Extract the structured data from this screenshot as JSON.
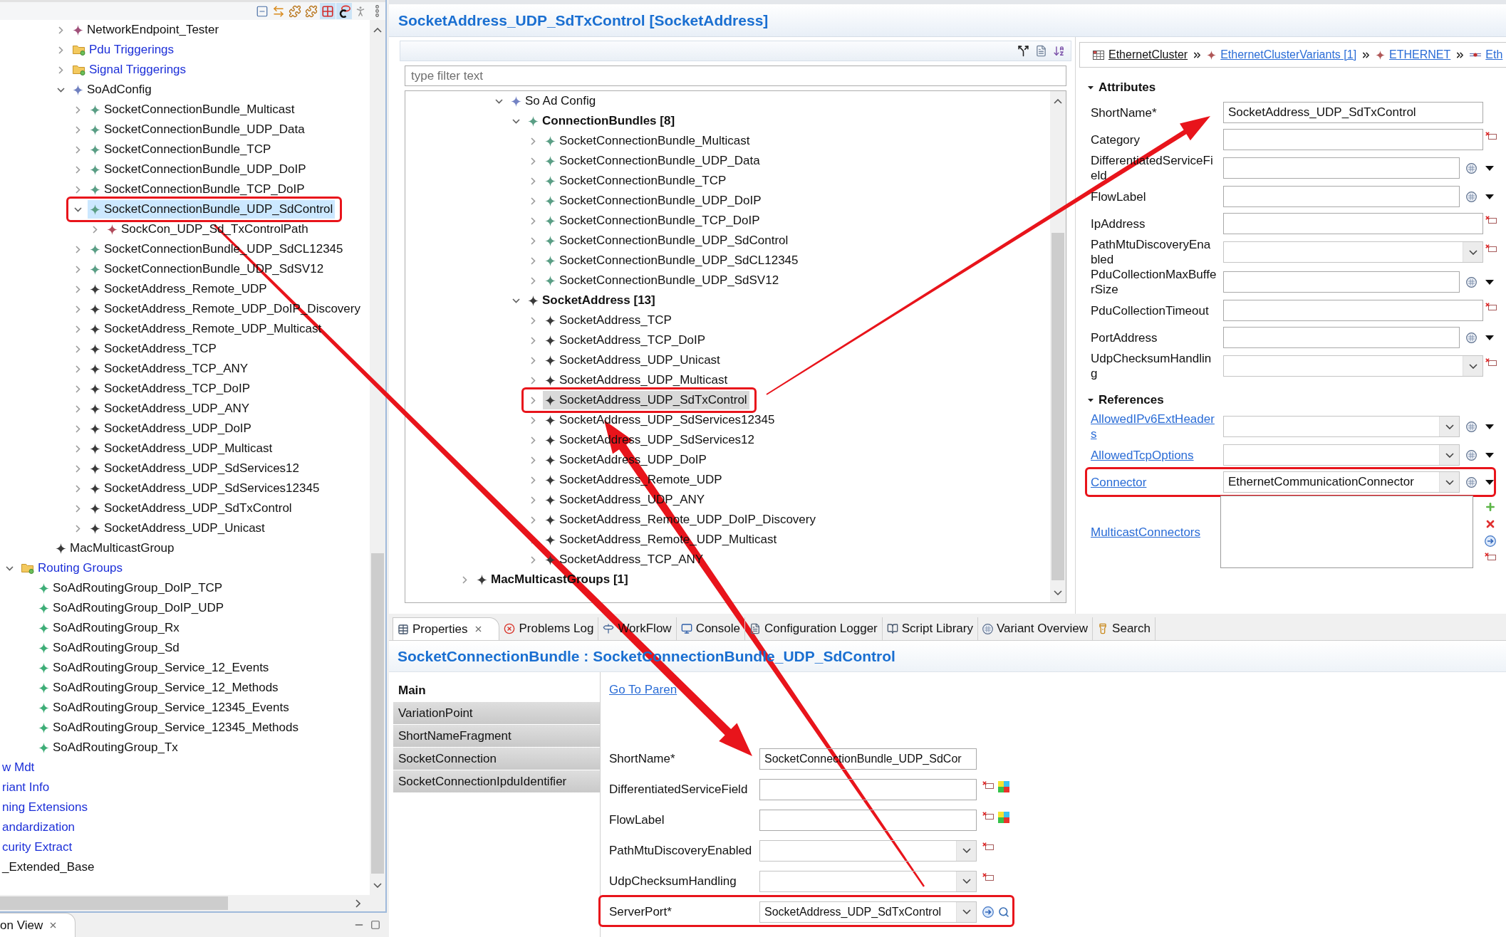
{
  "navigator": {
    "toolbar": [
      {
        "kind": "collapse",
        "pressed": false
      },
      {
        "kind": "sync",
        "pressed": false
      },
      {
        "kind": "puzzle",
        "pressed": false
      },
      {
        "kind": "puzzle",
        "pressed": false
      },
      {
        "kind": "grid",
        "pressed": true
      },
      {
        "kind": "ring",
        "pressed": true
      },
      {
        "kind": "figure",
        "pressed": false
      },
      {
        "kind": "menu",
        "pressed": false
      }
    ],
    "tree": [
      {
        "children": [
          {
            "children": [
              {
                "children": [
                  {
                    "children": [
                      {
                        "children": [
                          {
                            "label": "NetworkEndpoint_Tester",
                            "kind": "element",
                            "color": "#a0507a",
                            "expanded": false,
                            "selected": false,
                            "highlighted": false
                          },
                          {
                            "label": "Pdu Triggerings",
                            "kind": "folder",
                            "expanded": false,
                            "selected": false,
                            "highlighted": false
                          },
                          {
                            "label": "Signal Triggerings",
                            "kind": "folder",
                            "expanded": false,
                            "selected": false,
                            "highlighted": false
                          },
                          {
                            "label": "SoAdConfig",
                            "kind": "element",
                            "color": "#7080c0",
                            "expanded": true,
                            "selected": false,
                            "highlighted": false,
                            "children": [
                              {
                                "label": "SocketConnectionBundle_Multicast",
                                "kind": "element",
                                "color": "#5a9e85",
                                "expanded": false,
                                "selected": false,
                                "highlighted": false
                              },
                              {
                                "label": "SocketConnectionBundle_UDP_Data",
                                "kind": "element",
                                "color": "#5a9e85",
                                "expanded": false,
                                "selected": false,
                                "highlighted": false
                              },
                              {
                                "label": "SocketConnectionBundle_TCP",
                                "kind": "element",
                                "color": "#5a9e85",
                                "expanded": false,
                                "selected": false,
                                "highlighted": false
                              },
                              {
                                "label": "SocketConnectionBundle_UDP_DoIP",
                                "kind": "element",
                                "color": "#5a9e85",
                                "expanded": false,
                                "selected": false,
                                "highlighted": false
                              },
                              {
                                "label": "SocketConnectionBundle_TCP_DoIP",
                                "kind": "element",
                                "color": "#5a9e85",
                                "expanded": false,
                                "selected": false,
                                "highlighted": false
                              },
                              {
                                "label": "SocketConnectionBundle_UDP_SdControl",
                                "kind": "element",
                                "color": "#5a9e85",
                                "expanded": true,
                                "selected": true,
                                "highlighted": true,
                                "children": [
                                  {
                                    "label": "SockCon_UDP_Sd_TxControlPath",
                                    "kind": "element",
                                    "color": "#b04a5a",
                                    "expanded": false,
                                    "selected": false,
                                    "highlighted": false
                                  }
                                ]
                              },
                              {
                                "label": "SocketConnectionBundle_UDP_SdCL12345",
                                "kind": "element",
                                "color": "#5a9e85",
                                "expanded": false,
                                "selected": false,
                                "highlighted": false
                              },
                              {
                                "label": "SocketConnectionBundle_UDP_SdSV12",
                                "kind": "element",
                                "color": "#5a9e85",
                                "expanded": false,
                                "selected": false,
                                "highlighted": false
                              },
                              {
                                "label": "SocketAddress_Remote_UDP",
                                "kind": "element",
                                "color": "#3a3a3a",
                                "expanded": false,
                                "selected": false,
                                "highlighted": false
                              },
                              {
                                "label": "SocketAddress_Remote_UDP_DoIP_Discovery",
                                "kind": "element",
                                "color": "#3a3a3a",
                                "expanded": false,
                                "selected": false,
                                "highlighted": false
                              },
                              {
                                "label": "SocketAddress_Remote_UDP_Multicast",
                                "kind": "element",
                                "color": "#3a3a3a",
                                "expanded": false,
                                "selected": false,
                                "highlighted": false
                              },
                              {
                                "label": "SocketAddress_TCP",
                                "kind": "element",
                                "color": "#3a3a3a",
                                "expanded": false,
                                "selected": false,
                                "highlighted": false
                              },
                              {
                                "label": "SocketAddress_TCP_ANY",
                                "kind": "element",
                                "color": "#3a3a3a",
                                "expanded": false,
                                "selected": false,
                                "highlighted": false
                              },
                              {
                                "label": "SocketAddress_TCP_DoIP",
                                "kind": "element",
                                "color": "#3a3a3a",
                                "expanded": false,
                                "selected": false,
                                "highlighted": false
                              },
                              {
                                "label": "SocketAddress_UDP_ANY",
                                "kind": "element",
                                "color": "#3a3a3a",
                                "expanded": false,
                                "selected": false,
                                "highlighted": false
                              },
                              {
                                "label": "SocketAddress_UDP_DoIP",
                                "kind": "element",
                                "color": "#3a3a3a",
                                "expanded": false,
                                "selected": false,
                                "highlighted": false
                              },
                              {
                                "label": "SocketAddress_UDP_Multicast",
                                "kind": "element",
                                "color": "#3a3a3a",
                                "expanded": false,
                                "selected": false,
                                "highlighted": false
                              },
                              {
                                "label": "SocketAddress_UDP_SdServices12",
                                "kind": "element",
                                "color": "#3a3a3a",
                                "expanded": false,
                                "selected": false,
                                "highlighted": false
                              },
                              {
                                "label": "SocketAddress_UDP_SdServices12345",
                                "kind": "element",
                                "color": "#3a3a3a",
                                "expanded": false,
                                "selected": false,
                                "highlighted": false
                              },
                              {
                                "label": "SocketAddress_UDP_SdTxControl",
                                "kind": "element",
                                "color": "#3a3a3a",
                                "expanded": false,
                                "selected": false,
                                "highlighted": false
                              },
                              {
                                "label": "SocketAddress_UDP_Unicast",
                                "kind": "element",
                                "color": "#3a3a3a",
                                "expanded": false,
                                "selected": false,
                                "highlighted": false
                              }
                            ]
                          }
                        ]
                      },
                      {
                        "label": "MacMulticastGroup",
                        "kind": "element",
                        "color": "#3a3a3a",
                        "selected": false,
                        "highlighted": false
                      }
                    ]
                  }
                ]
              },
              {
                "label": "Routing Groups",
                "kind": "folder",
                "expanded": true,
                "selected": false,
                "highlighted": false,
                "children": [
                  {
                    "label": "SoAdRoutingGroup_DoIP_TCP",
                    "kind": "element",
                    "color": "#3fae78",
                    "selected": false,
                    "highlighted": false
                  },
                  {
                    "label": "SoAdRoutingGroup_DoIP_UDP",
                    "kind": "element",
                    "color": "#3fae78",
                    "selected": false,
                    "highlighted": false
                  },
                  {
                    "label": "SoAdRoutingGroup_Rx",
                    "kind": "element",
                    "color": "#3fae78",
                    "selected": false,
                    "highlighted": false
                  },
                  {
                    "label": "SoAdRoutingGroup_Sd",
                    "kind": "element",
                    "color": "#3fae78",
                    "selected": false,
                    "highlighted": false
                  },
                  {
                    "label": "SoAdRoutingGroup_Service_12_Events",
                    "kind": "element",
                    "color": "#3fae78",
                    "selected": false,
                    "highlighted": false
                  },
                  {
                    "label": "SoAdRoutingGroup_Service_12_Methods",
                    "kind": "element",
                    "color": "#3fae78",
                    "selected": false,
                    "highlighted": false
                  },
                  {
                    "label": "SoAdRoutingGroup_Service_12345_Events",
                    "kind": "element",
                    "color": "#3fae78",
                    "selected": false,
                    "highlighted": false
                  },
                  {
                    "label": "SoAdRoutingGroup_Service_12345_Methods",
                    "kind": "element",
                    "color": "#3fae78",
                    "selected": false,
                    "highlighted": false
                  },
                  {
                    "label": "SoAdRoutingGroup_Tx",
                    "kind": "element",
                    "color": "#3fae78",
                    "selected": false,
                    "highlighted": false
                  }
                ]
              }
            ]
          }
        ]
      },
      {
        "label": "w Mdt",
        "kind": "folder",
        "selected": false,
        "highlighted": false
      },
      {
        "label": "riant Info",
        "kind": "folder",
        "selected": false,
        "highlighted": false
      },
      {
        "label": "ning Extensions",
        "kind": "folder",
        "selected": false,
        "highlighted": false
      },
      {
        "label": "andardization",
        "kind": "folder",
        "selected": false,
        "highlighted": false
      },
      {
        "label": "curity Extract",
        "kind": "folder",
        "selected": false,
        "highlighted": false
      },
      {
        "label": "_Extended_Base",
        "kind": "element",
        "selected": false,
        "highlighted": false
      }
    ],
    "view_tabs": [
      {
        "label": "on View",
        "selected": true
      }
    ]
  },
  "editor": {
    "title": "SocketAddress_UDP_SdTxControl [SocketAddress]",
    "filter": {
      "placeholder": "type filter text"
    },
    "tree": [
      {
        "children": [
          {
            "children": [
              {
                "label": "So Ad Config",
                "kind": "element",
                "color": "#7483c4",
                "expanded": true,
                "selected": false,
                "highlighted": false,
                "children": [
                  {
                    "label": "ConnectionBundles [8]",
                    "kind": "group",
                    "color": "#5a9e85",
                    "expanded": true,
                    "selected": false,
                    "highlighted": false,
                    "children": [
                      {
                        "label": "SocketConnectionBundle_Multicast",
                        "kind": "element",
                        "color": "#5a9e85",
                        "expanded": false,
                        "selected": false,
                        "highlighted": false
                      },
                      {
                        "label": "SocketConnectionBundle_UDP_Data",
                        "kind": "element",
                        "color": "#5a9e85",
                        "expanded": false,
                        "selected": false,
                        "highlighted": false
                      },
                      {
                        "label": "SocketConnectionBundle_TCP",
                        "kind": "element",
                        "color": "#5a9e85",
                        "expanded": false,
                        "selected": false,
                        "highlighted": false
                      },
                      {
                        "label": "SocketConnectionBundle_UDP_DoIP",
                        "kind": "element",
                        "color": "#5a9e85",
                        "expanded": false,
                        "selected": false,
                        "highlighted": false
                      },
                      {
                        "label": "SocketConnectionBundle_TCP_DoIP",
                        "kind": "element",
                        "color": "#5a9e85",
                        "expanded": false,
                        "selected": false,
                        "highlighted": false
                      },
                      {
                        "label": "SocketConnectionBundle_UDP_SdControl",
                        "kind": "element",
                        "color": "#5a9e85",
                        "expanded": false,
                        "selected": false,
                        "highlighted": false
                      },
                      {
                        "label": "SocketConnectionBundle_UDP_SdCL12345",
                        "kind": "element",
                        "color": "#5a9e85",
                        "expanded": false,
                        "selected": false,
                        "highlighted": false
                      },
                      {
                        "label": "SocketConnectionBundle_UDP_SdSV12",
                        "kind": "element",
                        "color": "#5a9e85",
                        "expanded": false,
                        "selected": false,
                        "highlighted": false
                      }
                    ]
                  },
                  {
                    "label": "SocketAddress [13]",
                    "kind": "group",
                    "color": "#3a3a3a",
                    "expanded": true,
                    "selected": false,
                    "highlighted": false,
                    "children": [
                      {
                        "label": "SocketAddress_TCP",
                        "kind": "element",
                        "color": "#3a3a3a",
                        "expanded": false,
                        "selected": false,
                        "highlighted": false
                      },
                      {
                        "label": "SocketAddress_TCP_DoIP",
                        "kind": "element",
                        "color": "#3a3a3a",
                        "expanded": false,
                        "selected": false,
                        "highlighted": false
                      },
                      {
                        "label": "SocketAddress_UDP_Unicast",
                        "kind": "element",
                        "color": "#3a3a3a",
                        "expanded": false,
                        "selected": false,
                        "highlighted": false
                      },
                      {
                        "label": "SocketAddress_UDP_Multicast",
                        "kind": "element",
                        "color": "#3a3a3a",
                        "expanded": false,
                        "selected": false,
                        "highlighted": false
                      },
                      {
                        "label": "SocketAddress_UDP_SdTxControl",
                        "kind": "element",
                        "color": "#3a3a3a",
                        "expanded": false,
                        "selected": true,
                        "highlighted": true
                      },
                      {
                        "label": "SocketAddress_UDP_SdServices12345",
                        "kind": "element",
                        "color": "#3a3a3a",
                        "expanded": false,
                        "selected": false,
                        "highlighted": false
                      },
                      {
                        "label": "SocketAddress_UDP_SdServices12",
                        "kind": "element",
                        "color": "#3a3a3a",
                        "expanded": false,
                        "selected": false,
                        "highlighted": false
                      },
                      {
                        "label": "SocketAddress_UDP_DoIP",
                        "kind": "element",
                        "color": "#3a3a3a",
                        "expanded": false,
                        "selected": false,
                        "highlighted": false
                      },
                      {
                        "label": "SocketAddress_Remote_UDP",
                        "kind": "element",
                        "color": "#3a3a3a",
                        "expanded": false,
                        "selected": false,
                        "highlighted": false
                      },
                      {
                        "label": "SocketAddress_UDP_ANY",
                        "kind": "element",
                        "color": "#3a3a3a",
                        "expanded": false,
                        "selected": false,
                        "highlighted": false
                      },
                      {
                        "label": "SocketAddress_Remote_UDP_DoIP_Discovery",
                        "kind": "element",
                        "color": "#3a3a3a",
                        "expanded": false,
                        "selected": false,
                        "highlighted": false
                      },
                      {
                        "label": "SocketAddress_Remote_UDP_Multicast",
                        "kind": "element",
                        "color": "#3a3a3a",
                        "expanded": false,
                        "selected": false,
                        "highlighted": false
                      },
                      {
                        "label": "SocketAddress_TCP_ANY",
                        "kind": "element",
                        "color": "#3a3a3a",
                        "expanded": false,
                        "selected": false,
                        "highlighted": false
                      }
                    ]
                  }
                ]
              }
            ]
          }
        ]
      },
      {
        "label": "MacMulticastGroups [1]",
        "kind": "group",
        "color": "#3a3a3a",
        "expanded": false,
        "selected": false,
        "highlighted": false
      }
    ],
    "breadcrumb": [
      {
        "label": "EthernetCluster",
        "kind": "cluster"
      },
      {
        "label": "EthernetClusterVariants [1]",
        "kind": "variant"
      },
      {
        "label": "ETHERNET",
        "kind": "variant"
      },
      {
        "label": "Eth",
        "kind": "connector"
      }
    ],
    "sections": [
      {
        "title": "Attributes",
        "expanded": true,
        "rows": [
          {
            "label": "ShortName*",
            "kind": "name",
            "value": "SocketAddress_UDP_SdTxControl",
            "highlighted": false
          },
          {
            "label": "Category",
            "kind": "text",
            "highlighted": false
          },
          {
            "label": "DifferentiatedServiceField",
            "kind": "variant",
            "highlighted": false
          },
          {
            "label": "FlowLabel",
            "kind": "variant",
            "highlighted": false
          },
          {
            "label": "IpAddress",
            "kind": "text",
            "highlighted": false
          },
          {
            "label": "PathMtuDiscoveryEnabled",
            "kind": "enum",
            "highlighted": false
          },
          {
            "label": "PduCollectionMaxBufferSize",
            "kind": "variant",
            "highlighted": false
          },
          {
            "label": "PduCollectionTimeout",
            "kind": "text",
            "highlighted": false
          },
          {
            "label": "PortAddress",
            "kind": "variant",
            "highlighted": false
          },
          {
            "label": "UdpChecksumHandling",
            "kind": "enum",
            "highlighted": false
          }
        ]
      },
      {
        "title": "References",
        "expanded": true,
        "rows": [
          {
            "label": "AllowedIPv6ExtHeaders",
            "kind": "reference",
            "highlighted": false
          },
          {
            "label": "AllowedTcpOptions",
            "kind": "reference",
            "highlighted": false
          },
          {
            "label": "Connector",
            "kind": "reference",
            "value": "EthernetCommunicationConnector",
            "highlighted": true
          },
          {
            "label": "MulticastConnectors",
            "kind": "list",
            "highlighted": false
          }
        ]
      }
    ]
  },
  "properties_view": {
    "tabs": [
      {
        "label": "Properties",
        "kind": "properties",
        "selected": true
      },
      {
        "label": "Problems Log",
        "kind": "problems",
        "selected": false
      },
      {
        "label": "WorkFlow",
        "kind": "workflow",
        "selected": false
      },
      {
        "label": "Console",
        "kind": "console",
        "selected": false
      },
      {
        "label": "Configuration Logger",
        "kind": "logger",
        "selected": false
      },
      {
        "label": "Script Library",
        "kind": "library",
        "selected": false
      },
      {
        "label": "Variant Overview",
        "kind": "variants",
        "selected": false
      },
      {
        "label": "Search",
        "kind": "search",
        "selected": false
      }
    ],
    "title": "SocketConnectionBundle : SocketConnectionBundle_UDP_SdControl",
    "pages": [
      {
        "label": "Main",
        "selected": true
      },
      {
        "label": "VariationPoint",
        "selected": false
      },
      {
        "label": "ShortNameFragment",
        "selected": false
      },
      {
        "label": "SocketConnection",
        "selected": false
      },
      {
        "label": "SocketConnectionIpduIdentifier",
        "selected": false
      }
    ],
    "link": "Go To Paren",
    "rows": [
      {
        "label": "ShortName*",
        "kind": "name",
        "value": "SocketConnectionBundle_UDP_SdCor",
        "highlighted": false
      },
      {
        "label": "DifferentiatedServiceField",
        "kind": "number",
        "highlighted": false
      },
      {
        "label": "FlowLabel",
        "kind": "number",
        "highlighted": false
      },
      {
        "label": "PathMtuDiscoveryEnabled",
        "kind": "enum",
        "highlighted": false
      },
      {
        "label": "UdpChecksumHandling",
        "kind": "enum",
        "highlighted": false
      },
      {
        "label": "ServerPort*",
        "kind": "reference",
        "value": "SocketAddress_UDP_SdTxControl",
        "highlighted": true
      }
    ]
  }
}
